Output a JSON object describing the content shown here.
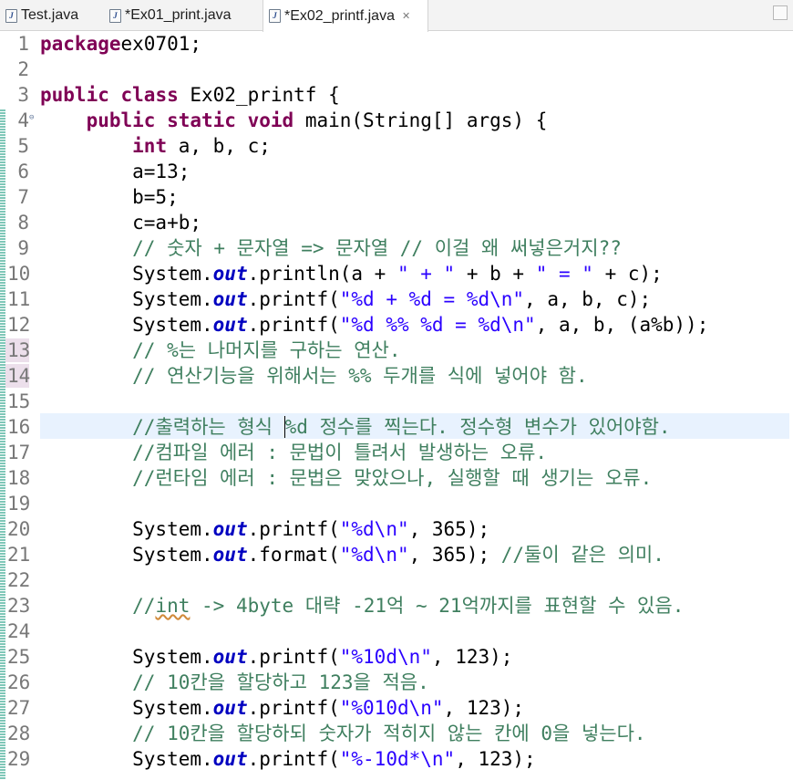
{
  "tabs": [
    {
      "label": "Test.java",
      "active": false
    },
    {
      "label": "*Ex01_print.java",
      "active": false
    },
    {
      "label": "*Ex02_printf.java",
      "active": true
    }
  ],
  "colors": {
    "keyword": "#7f0055",
    "string": "#2a00ff",
    "comment": "#3f7f5f",
    "field": "#0000c0",
    "current_line": "#e8f2fe"
  },
  "icons": {
    "file": "java-file-icon",
    "close": "close-icon",
    "fold": "fold-collapse-icon",
    "maximize": "maximize-icon"
  },
  "cursor": {
    "line": 16
  },
  "lines": [
    {
      "n": "1",
      "segs": [
        [
          "kw",
          "package"
        ],
        [
          "",
          "ex0701;"
        ]
      ]
    },
    {
      "n": "2",
      "segs": []
    },
    {
      "n": "3",
      "segs": [
        [
          "kw",
          "public"
        ],
        [
          "",
          " "
        ],
        [
          "kw",
          "class"
        ],
        [
          "",
          " Ex02_printf {"
        ]
      ]
    },
    {
      "n": "4",
      "fold": true,
      "segs": [
        [
          "",
          "    "
        ],
        [
          "kw",
          "public"
        ],
        [
          "",
          " "
        ],
        [
          "kw",
          "static"
        ],
        [
          "",
          " "
        ],
        [
          "kw",
          "void"
        ],
        [
          "",
          " main(String[] args) {"
        ]
      ]
    },
    {
      "n": "5",
      "segs": [
        [
          "",
          "        "
        ],
        [
          "kw",
          "int"
        ],
        [
          "",
          " a, b, c;"
        ]
      ]
    },
    {
      "n": "6",
      "segs": [
        [
          "",
          "        a=13;"
        ]
      ]
    },
    {
      "n": "7",
      "segs": [
        [
          "",
          "        b=5;"
        ]
      ]
    },
    {
      "n": "8",
      "segs": [
        [
          "",
          "        c=a+b;"
        ]
      ]
    },
    {
      "n": "9",
      "segs": [
        [
          "",
          "        "
        ],
        [
          "cm",
          "// 숫자 + 문자열 => 문자열 // 이걸 왜 써넣은거지??"
        ]
      ]
    },
    {
      "n": "10",
      "segs": [
        [
          "",
          "        System."
        ],
        [
          "fld",
          "out"
        ],
        [
          "",
          ".println(a + "
        ],
        [
          "str",
          "\" + \""
        ],
        [
          "",
          " + b + "
        ],
        [
          "str",
          "\" = \""
        ],
        [
          "",
          " + c);"
        ]
      ]
    },
    {
      "n": "11",
      "segs": [
        [
          "",
          "        System."
        ],
        [
          "fld",
          "out"
        ],
        [
          "",
          ".printf("
        ],
        [
          "str",
          "\"%d + %d = %d\\n\""
        ],
        [
          "",
          ", a, b, c);"
        ]
      ]
    },
    {
      "n": "12",
      "segs": [
        [
          "",
          "        System."
        ],
        [
          "fld",
          "out"
        ],
        [
          "",
          ".printf("
        ],
        [
          "str",
          "\"%d %% %d = %d\\n\""
        ],
        [
          "",
          ", a, b, (a%b));"
        ]
      ]
    },
    {
      "n": "13",
      "segs": [
        [
          "",
          "        "
        ],
        [
          "cm",
          "// %는 나머지를 구하는 연산."
        ]
      ]
    },
    {
      "n": "14",
      "segs": [
        [
          "",
          "        "
        ],
        [
          "cm",
          "// 연산기능을 위해서는 %% 두개를 식에 넣어야 함."
        ]
      ]
    },
    {
      "n": "15",
      "segs": []
    },
    {
      "n": "16",
      "segs": [
        [
          "",
          "        "
        ],
        [
          "cm",
          "//출력하는 형식 "
        ],
        [
          "caret",
          "%d 정수를 찍는다. 정수형 변수가 있어야함."
        ]
      ]
    },
    {
      "n": "17",
      "segs": [
        [
          "",
          "        "
        ],
        [
          "cm",
          "//컴파일 에러 : 문법이 틀려서 발생하는 오류."
        ]
      ]
    },
    {
      "n": "18",
      "segs": [
        [
          "",
          "        "
        ],
        [
          "cm",
          "//런타임 에러 : 문법은 맞았으나, 실행할 때 생기는 오류."
        ]
      ]
    },
    {
      "n": "19",
      "segs": []
    },
    {
      "n": "20",
      "segs": [
        [
          "",
          "        System."
        ],
        [
          "fld",
          "out"
        ],
        [
          "",
          ".printf("
        ],
        [
          "str",
          "\"%d\\n\""
        ],
        [
          "",
          ", 365);"
        ]
      ]
    },
    {
      "n": "21",
      "segs": [
        [
          "",
          "        System."
        ],
        [
          "fld",
          "out"
        ],
        [
          "",
          ".format("
        ],
        [
          "str",
          "\"%d\\n\""
        ],
        [
          "",
          ", 365); "
        ],
        [
          "cm",
          "//둘이 같은 의미."
        ]
      ]
    },
    {
      "n": "22",
      "segs": []
    },
    {
      "n": "23",
      "segs": [
        [
          "",
          "        "
        ],
        [
          "cm",
          "//"
        ],
        [
          "cmsq",
          "int"
        ],
        [
          "cm",
          " -> 4byte 대략 -21억 ~ 21억까지를 표현할 수 있음."
        ]
      ]
    },
    {
      "n": "24",
      "segs": []
    },
    {
      "n": "25",
      "segs": [
        [
          "",
          "        System."
        ],
        [
          "fld",
          "out"
        ],
        [
          "",
          ".printf("
        ],
        [
          "str",
          "\"%10d\\n\""
        ],
        [
          "",
          ", 123);"
        ]
      ]
    },
    {
      "n": "26",
      "segs": [
        [
          "",
          "        "
        ],
        [
          "cm",
          "// 10칸을 할당하고 123을 적음."
        ]
      ]
    },
    {
      "n": "27",
      "segs": [
        [
          "",
          "        System."
        ],
        [
          "fld",
          "out"
        ],
        [
          "",
          ".printf("
        ],
        [
          "str",
          "\"%010d\\n\""
        ],
        [
          "",
          ", 123);"
        ]
      ]
    },
    {
      "n": "28",
      "segs": [
        [
          "",
          "        "
        ],
        [
          "cm",
          "// 10칸을 할당하되 숫자가 적히지 않는 칸에 0을 넣는다."
        ]
      ]
    },
    {
      "n": "29",
      "segs": [
        [
          "",
          "        System."
        ],
        [
          "fld",
          "out"
        ],
        [
          "",
          ".printf("
        ],
        [
          "str",
          "\"%-10d*\\n\""
        ],
        [
          "",
          ", 123);"
        ]
      ]
    }
  ]
}
